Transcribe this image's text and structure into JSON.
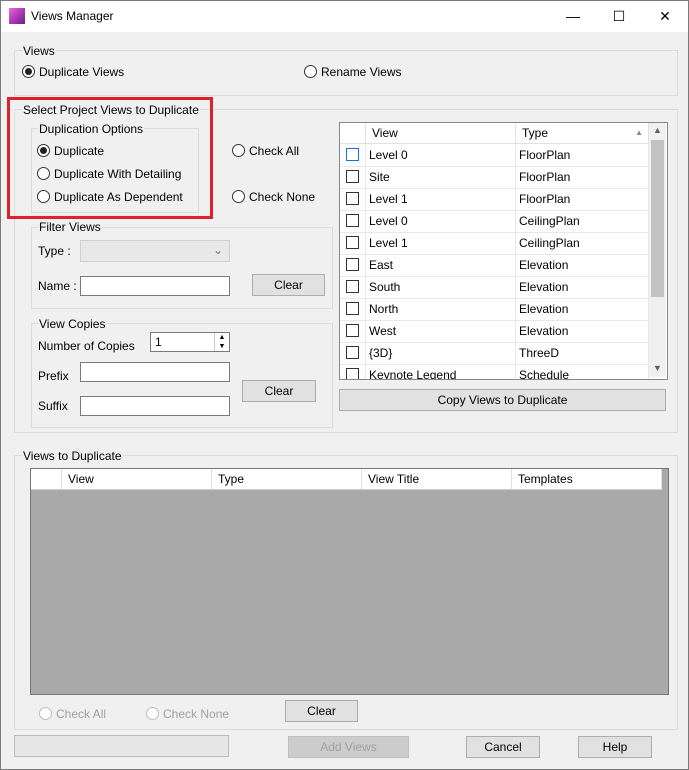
{
  "window": {
    "title": "Views Manager",
    "minimize": "—",
    "maximize": "☐",
    "close": "✕"
  },
  "views_group": {
    "label": "Views",
    "options": [
      "Duplicate Views",
      "Rename Views"
    ]
  },
  "select_group": {
    "label": "Select Project Views to Duplicate"
  },
  "dup_options": {
    "label": "Duplication Options",
    "items": [
      "Duplicate",
      "Duplicate With Detailing",
      "Duplicate As Dependent"
    ]
  },
  "check_all": "Check All",
  "check_none": "Check None",
  "filter": {
    "label": "Filter Views",
    "type_label": "Type :",
    "name_label": "Name :",
    "clear": "Clear"
  },
  "copies": {
    "label": "View Copies",
    "number_label": "Number of Copies",
    "number_value": "1",
    "prefix_label": "Prefix",
    "suffix_label": "Suffix",
    "clear": "Clear"
  },
  "project_grid": {
    "headers": [
      "View",
      "Type"
    ],
    "rows": [
      {
        "view": "Level 0",
        "type": "FloorPlan"
      },
      {
        "view": "Site",
        "type": "FloorPlan"
      },
      {
        "view": "Level 1",
        "type": "FloorPlan"
      },
      {
        "view": "Level 0",
        "type": "CeilingPlan"
      },
      {
        "view": "Level 1",
        "type": "CeilingPlan"
      },
      {
        "view": "East",
        "type": "Elevation"
      },
      {
        "view": "South",
        "type": "Elevation"
      },
      {
        "view": "North",
        "type": "Elevation"
      },
      {
        "view": "West",
        "type": "Elevation"
      },
      {
        "view": "{3D}",
        "type": "ThreeD"
      },
      {
        "view": "Keynote Legend",
        "type": "Schedule"
      }
    ]
  },
  "copy_button": "Copy Views to Duplicate",
  "dup_group": {
    "label": "Views to Duplicate",
    "headers": [
      "View",
      "Type",
      "View Title",
      "Templates"
    ]
  },
  "bottom": {
    "check_all": "Check All",
    "check_none": "Check None",
    "clear": "Clear",
    "add_views": "Add Views",
    "cancel": "Cancel",
    "help": "Help"
  }
}
